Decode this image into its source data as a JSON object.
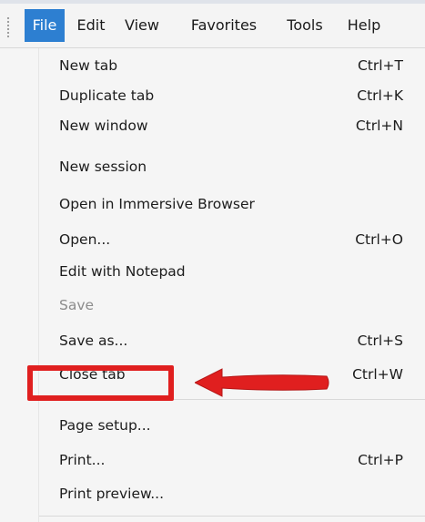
{
  "menubar": {
    "items": [
      {
        "label": "File",
        "active": true
      },
      {
        "label": "Edit",
        "active": false
      },
      {
        "label": "View",
        "active": false
      },
      {
        "label": "Favorites",
        "active": false
      },
      {
        "label": "Tools",
        "active": false
      },
      {
        "label": "Help",
        "active": false
      }
    ]
  },
  "file_menu": {
    "items": [
      {
        "label": "New tab",
        "shortcut": "Ctrl+T",
        "enabled": true
      },
      {
        "label": "Duplicate tab",
        "shortcut": "Ctrl+K",
        "enabled": true
      },
      {
        "label": "New window",
        "shortcut": "Ctrl+N",
        "enabled": true
      },
      {
        "label": "New session",
        "shortcut": "",
        "enabled": true
      },
      {
        "label": "Open in Immersive Browser",
        "shortcut": "",
        "enabled": true
      },
      {
        "label": "Open...",
        "shortcut": "Ctrl+O",
        "enabled": true
      },
      {
        "label": "Edit with Notepad",
        "shortcut": "",
        "enabled": true
      },
      {
        "label": "Save",
        "shortcut": "",
        "enabled": false
      },
      {
        "label": "Save as...",
        "shortcut": "Ctrl+S",
        "enabled": true
      },
      {
        "label": "Close tab",
        "shortcut": "Ctrl+W",
        "enabled": true
      },
      {
        "label": "Page setup...",
        "shortcut": "",
        "enabled": true,
        "highlighted": true
      },
      {
        "label": "Print...",
        "shortcut": "Ctrl+P",
        "enabled": true
      },
      {
        "label": "Print preview...",
        "shortcut": "",
        "enabled": true
      }
    ]
  },
  "annotation": {
    "color": "#e01f1f",
    "target": "Page setup..."
  },
  "colors": {
    "menubar_active_bg": "#2d7fd1",
    "menu_bg": "#f5f5f5",
    "disabled_text": "#8c8c8c"
  }
}
